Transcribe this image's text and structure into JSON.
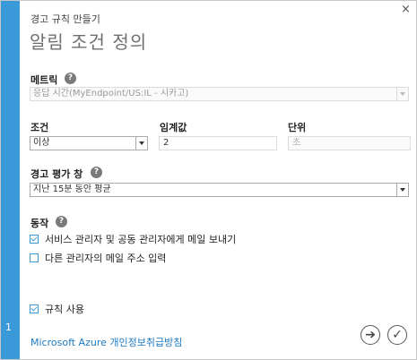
{
  "dialog": {
    "subtitle": "경고 규칙 만들기",
    "title": "알림 조건 정의",
    "close_glyph": "×",
    "step_number": "1"
  },
  "metric": {
    "label": "메트릭",
    "value": "응답 시간(MyEndpoint/US:IL - 시카고)"
  },
  "condition": {
    "label": "조건",
    "value": "이상"
  },
  "threshold": {
    "label": "임계값",
    "value": "2"
  },
  "unit": {
    "label": "단위",
    "value": "초"
  },
  "window": {
    "label": "경고 평가 창",
    "value": "지난 15분 동안 평균"
  },
  "actions": {
    "label": "동작",
    "items": [
      {
        "label": "서비스 관리자 및 공동 관리자에게 메일 보내기",
        "checked": true
      },
      {
        "label": "다른 관리자의 메일 주소 입력",
        "checked": false
      }
    ]
  },
  "enable_rule": {
    "label": "규칙 사용",
    "checked": true
  },
  "footer": {
    "privacy_link": "Microsoft Azure 개인정보취급방침",
    "next_glyph": "➔",
    "done_glyph": "✓"
  },
  "help_glyph": "?",
  "colors": {
    "accent": "#3a9ad9",
    "link": "#1e7bc3"
  }
}
